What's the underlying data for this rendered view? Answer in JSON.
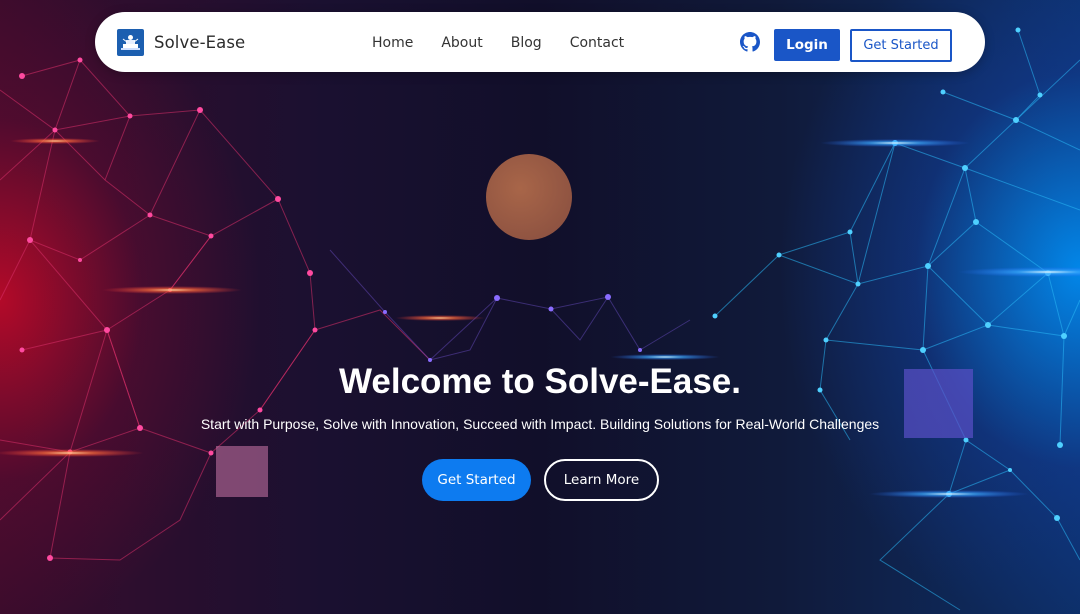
{
  "navbar": {
    "brand_name": "Solve-Ease",
    "links": [
      "Home",
      "About",
      "Blog",
      "Contact"
    ],
    "github_icon": "github-icon",
    "login_label": "Login",
    "get_started_label": "Get Started"
  },
  "hero": {
    "headline": "Welcome to Solve-Ease.",
    "subheadline": "Start with Purpose, Solve with Innovation, Succeed with Impact. Building Solutions for Real-World Challenges",
    "primary_button": "Get Started",
    "secondary_button": "Learn More"
  },
  "colors": {
    "accent_blue": "#1a56c7",
    "hero_button_blue": "#0d7bf0",
    "network_left": "#e0306a",
    "network_right": "#2ab8f5"
  }
}
